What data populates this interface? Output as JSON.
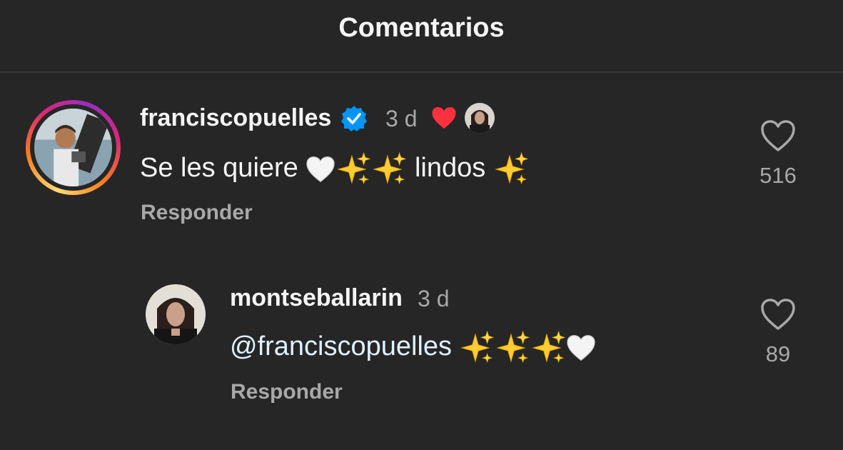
{
  "header": {
    "title": "Comentarios"
  },
  "comments": [
    {
      "username": "franciscopuelles",
      "verified": true,
      "time": "3 d",
      "liked_by_author": true,
      "text_before": "Se les quiere",
      "text_middle": "lindos",
      "reply_label": "Responder",
      "likes": "516"
    },
    {
      "username": "montseballarin",
      "verified": false,
      "time": "3 d",
      "mention": "@franciscopuelles",
      "reply_label": "Responder",
      "likes": "89"
    }
  ],
  "icons": {
    "verified": "verified-badge-icon",
    "author_like": "red-heart-icon",
    "like": "heart-outline-icon",
    "white_heart": "white-heart-emoji",
    "sparkles": "sparkles-emoji"
  },
  "colors": {
    "background": "#262626",
    "verified_blue": "#0095f6",
    "red_heart": "#ff3040",
    "sparkle_yellow": "#ffcc33",
    "secondary_text": "#a8a8a8"
  }
}
